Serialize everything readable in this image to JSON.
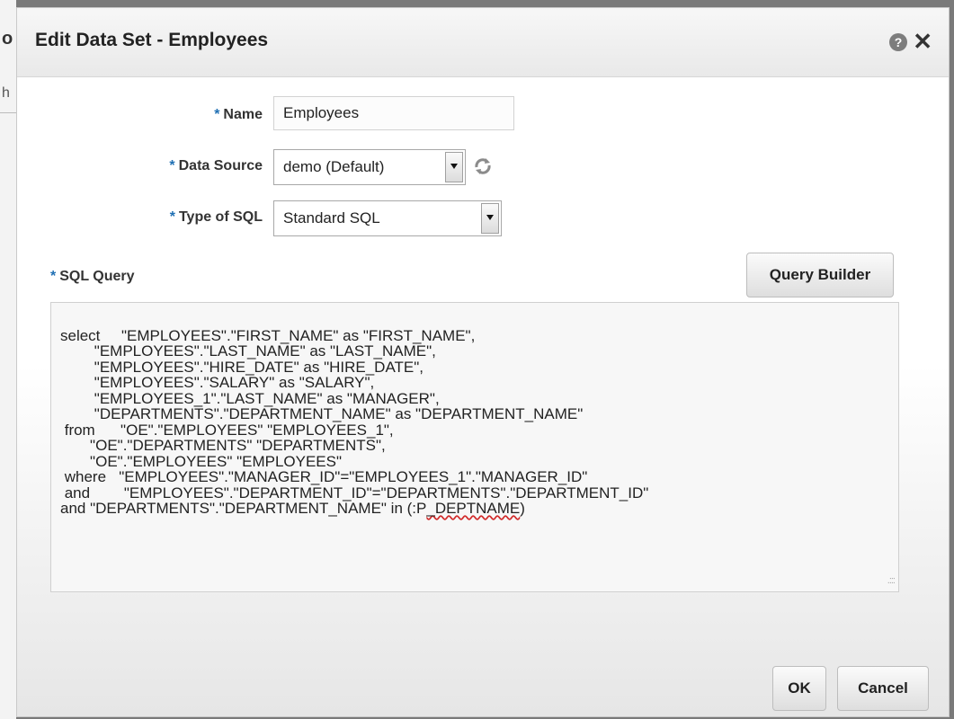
{
  "background": {
    "partial_glyph_1": "o",
    "partial_glyph_2": "h"
  },
  "dialog": {
    "title": "Edit Data Set - Employees",
    "help_icon": "help-icon",
    "close_icon": "close-icon"
  },
  "form": {
    "required_marker": "*",
    "name_label": "Name",
    "name_value": "Employees",
    "data_source_label": "Data Source",
    "data_source_value": "demo (Default)",
    "type_of_sql_label": "Type of SQL",
    "type_of_sql_value": "Standard SQL",
    "sql_query_label": "SQL Query",
    "query_builder_label": "Query Builder"
  },
  "sql": {
    "lines": [
      "select     \"EMPLOYEES\".\"FIRST_NAME\" as \"FIRST_NAME\",",
      "        \"EMPLOYEES\".\"LAST_NAME\" as \"LAST_NAME\",",
      "        \"EMPLOYEES\".\"HIRE_DATE\" as \"HIRE_DATE\",",
      "        \"EMPLOYEES\".\"SALARY\" as \"SALARY\",",
      "        \"EMPLOYEES_1\".\"LAST_NAME\" as \"MANAGER\",",
      "        \"DEPARTMENTS\".\"DEPARTMENT_NAME\" as \"DEPARTMENT_NAME\"",
      " from      \"OE\".\"EMPLOYEES\" \"EMPLOYEES_1\",",
      "       \"OE\".\"DEPARTMENTS\" \"DEPARTMENTS\",",
      "       \"OE\".\"EMPLOYEES\" \"EMPLOYEES\"",
      " where   \"EMPLOYEES\".\"MANAGER_ID\"=\"EMPLOYEES_1\".\"MANAGER_ID\"",
      " and        \"EMPLOYEES\".\"DEPARTMENT_ID\"=\"DEPARTMENTS\".\"DEPARTMENT_ID\""
    ],
    "last_line_prefix": "and \"DEPARTMENTS\".\"DEPARTMENT_NAME\" in (:P",
    "last_line_flagged": "_DEPTNAME",
    "last_line_suffix": ")"
  },
  "buttons": {
    "ok": "OK",
    "cancel": "Cancel"
  }
}
